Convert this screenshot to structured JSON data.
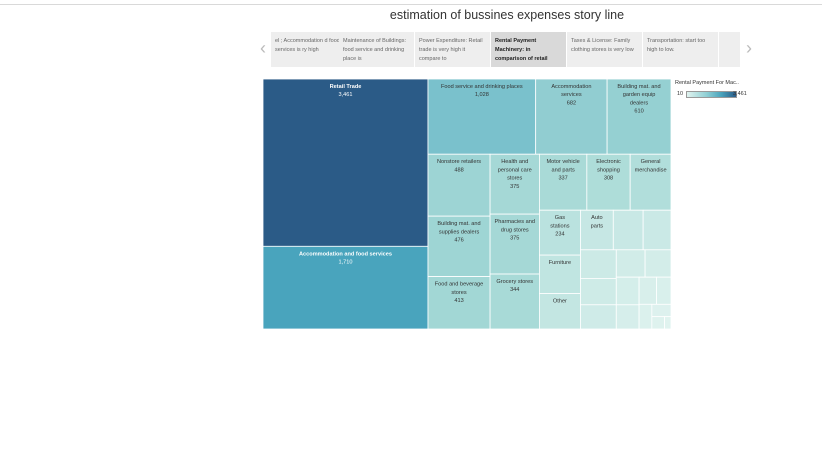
{
  "title": "estimation of bussines expenses story line",
  "story": {
    "prev_icon": "chevron-left-icon",
    "next_icon": "chevron-right-icon",
    "prev_glyph": "‹",
    "next_glyph": "›",
    "points": [
      {
        "text": "el ; Accommodation d food services is ry high",
        "active": false
      },
      {
        "text": "Maintenance of Buildings: food service and drinking place is",
        "active": false
      },
      {
        "text": "Power Expenditure: Retail trade is very high it compare to",
        "active": false
      },
      {
        "text": "Rental Payment Machinery: in comparison of retail",
        "active": true
      },
      {
        "text": "Taxes & License: Family clothing stores is very low",
        "active": false
      },
      {
        "text": "Transportation: start too high to low.",
        "active": false
      }
    ]
  },
  "legend": {
    "title": "Rental Payment For Mac..",
    "min_label": "10",
    "max_label": "3,461",
    "color_low": "#e0f3ef",
    "color_high": "#2b5b87"
  },
  "chart_data": {
    "type": "treemap",
    "title": "",
    "measure": "Rental Payment For Mac..",
    "color_scale": {
      "min": 10,
      "max": 3461,
      "low": "#e0f3ef",
      "high": "#2b5b87"
    },
    "groups": [
      {
        "items": [
          {
            "name": "Retail Trade",
            "value": 3461,
            "show_value": true
          },
          {
            "name": "Accommodation and food services",
            "value": 1710,
            "show_value": true
          }
        ]
      },
      {
        "items": [
          {
            "name": "Food service and drinking places",
            "value": 1028,
            "show_value": true
          },
          {
            "name": "Accommodation services",
            "value": 682,
            "show_value": true
          },
          {
            "name": "Building mat. and garden equip dealers",
            "value": 610,
            "show_value": true
          },
          {
            "name": "Nonstore retailers",
            "value": 488,
            "show_value": true
          },
          {
            "name": "Building mat. and supplies dealers",
            "value": 476,
            "show_value": true
          },
          {
            "name": "Food and beverage stores",
            "value": 413,
            "show_value": true
          },
          {
            "name": "Health and personal care stores",
            "value": 375,
            "show_value": true
          },
          {
            "name": "Pharmacies and drug stores",
            "value": 375,
            "show_value": true
          },
          {
            "name": "Grocery stores",
            "value": 344,
            "show_value": true
          },
          {
            "name": "Motor vehicle and parts",
            "value": 337,
            "show_value": true
          },
          {
            "name": "Electronic shopping",
            "value": 308,
            "show_value": true
          },
          {
            "name": "General merchandise",
            "value": 290,
            "show_value": false
          },
          {
            "name": "Gas stations",
            "value": 234,
            "show_value": true
          },
          {
            "name": "Furniture",
            "value": 200,
            "show_value": false
          },
          {
            "name": "Other",
            "value": 185,
            "show_value": false
          },
          {
            "name": "Auto parts",
            "value": 165,
            "show_value": false
          },
          {
            "name": "",
            "value": 150
          },
          {
            "name": "",
            "value": 140
          },
          {
            "name": "",
            "value": 130
          },
          {
            "name": "",
            "value": 120
          },
          {
            "name": "",
            "value": 110
          },
          {
            "name": "",
            "value": 100
          },
          {
            "name": "",
            "value": 90
          },
          {
            "name": "",
            "value": 80
          },
          {
            "name": "",
            "value": 70
          },
          {
            "name": "",
            "value": 60
          },
          {
            "name": "",
            "value": 50
          },
          {
            "name": "",
            "value": 40
          },
          {
            "name": "",
            "value": 30
          },
          {
            "name": "",
            "value": 20
          },
          {
            "name": "",
            "value": 10
          }
        ]
      }
    ]
  }
}
